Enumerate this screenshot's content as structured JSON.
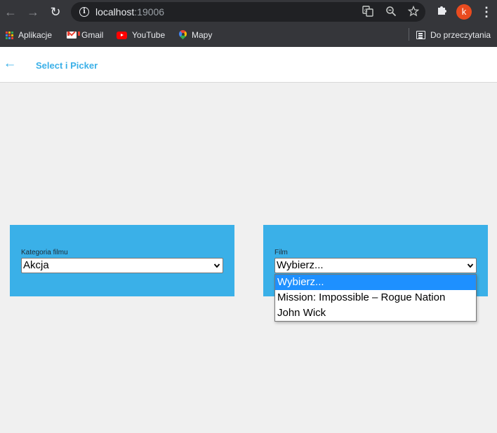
{
  "browser": {
    "url_host": "localhost",
    "url_port": ":19006",
    "avatar_letter": "k",
    "nav_icons": [
      "back-arrow-icon",
      "forward-arrow-icon",
      "reload-icon"
    ],
    "omnibox_icons": [
      "info-icon",
      "translate-icon",
      "zoom-icon",
      "bookmark-star-icon"
    ],
    "extension_icon": "puzzle-icon",
    "avatar_color": "#e94b1f"
  },
  "bookmarks": {
    "items": [
      {
        "label": "Aplikacje",
        "icon": "apps-grid-icon"
      },
      {
        "label": "Gmail",
        "icon": "gmail-icon"
      },
      {
        "label": "YouTube",
        "icon": "youtube-icon"
      },
      {
        "label": "Mapy",
        "icon": "maps-icon"
      }
    ],
    "reading_list": {
      "label": "Do przeczytania",
      "icon": "reading-list-icon"
    }
  },
  "app": {
    "title": "Select i Picker",
    "accent_color": "#3ab0e8",
    "category_select": {
      "label": "Kategoria filmu",
      "value": "Akcja"
    },
    "film_select": {
      "label": "Film",
      "value": "Wybierz...",
      "open": true,
      "options": [
        "Wybierz...",
        "Mission: Impossible – Rogue Nation",
        "John Wick"
      ],
      "highlighted_index": 0
    }
  }
}
